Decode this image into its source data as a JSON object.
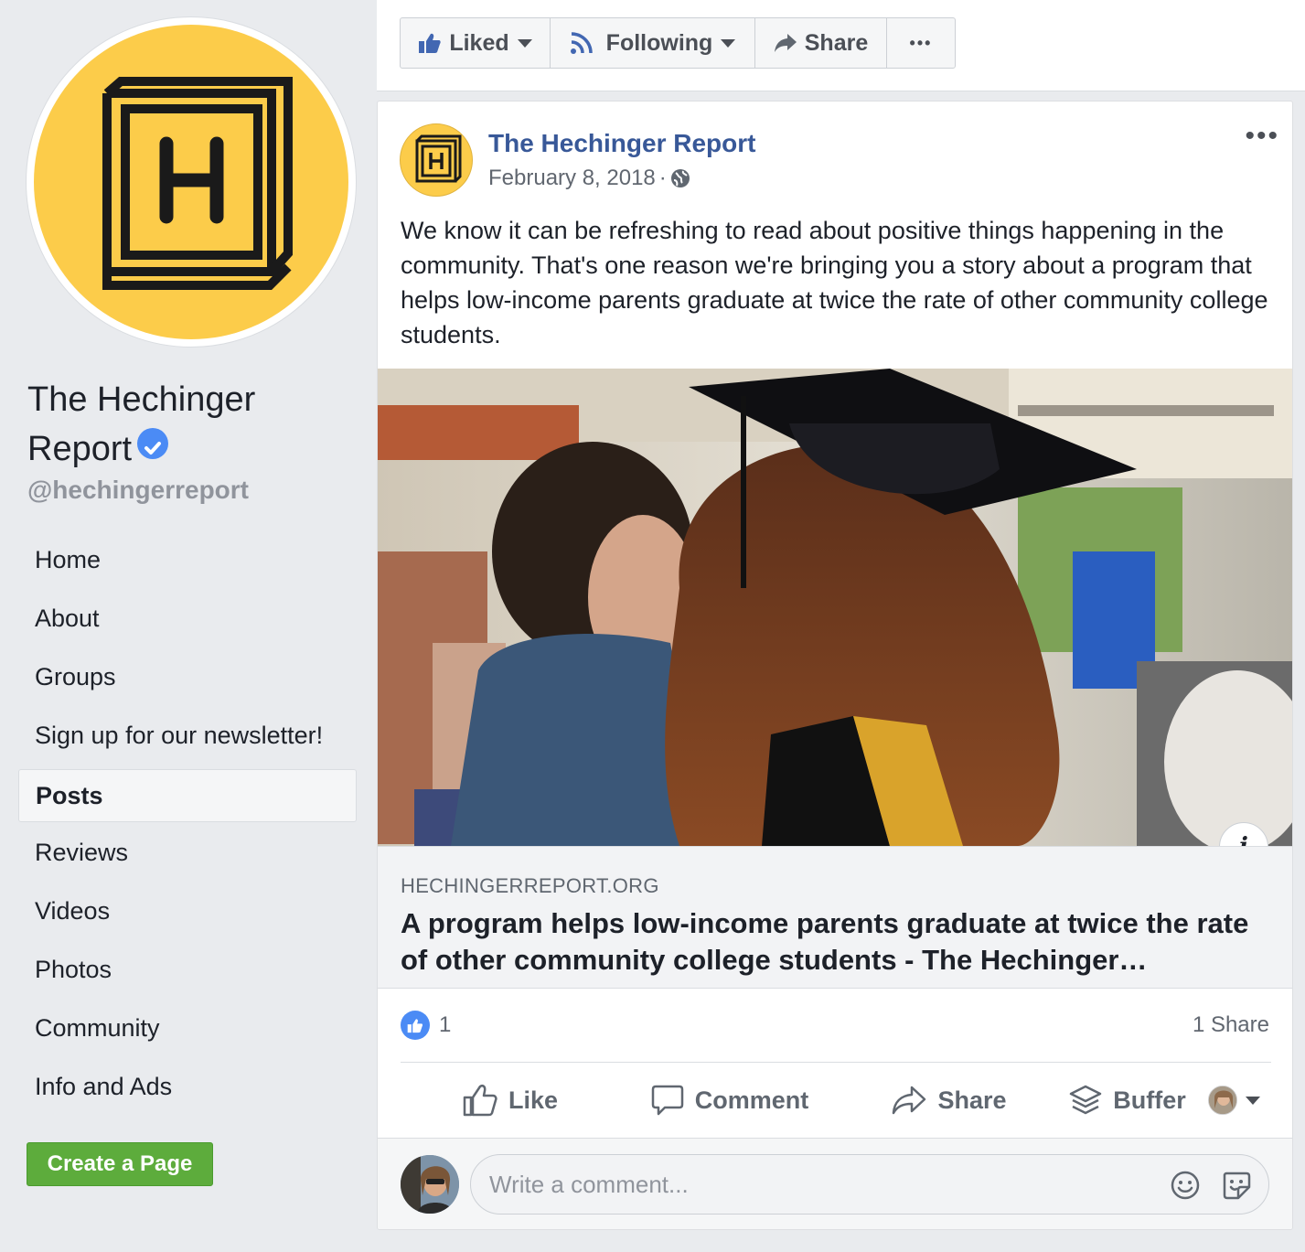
{
  "page": {
    "name_line1": "The Hechinger",
    "name_line2": "Report",
    "handle": "@hechingerreport",
    "logo_letter": "H",
    "brand_yellow": "#fccc4a"
  },
  "nav": {
    "items": [
      "Home",
      "About",
      "Groups",
      "Sign up for our newsletter!",
      "Posts",
      "Reviews",
      "Videos",
      "Photos",
      "Community",
      "Info and Ads"
    ],
    "active": "Posts"
  },
  "create_page_label": "Create a Page",
  "toolbar": {
    "liked_label": "Liked",
    "following_label": "Following",
    "share_label": "Share",
    "more_label": "•••"
  },
  "post": {
    "author": "The Hechinger Report",
    "date": "February 8, 2018",
    "separator": "·",
    "more_label": "•••",
    "text": "We know it can be refreshing to read about positive things happening in the community. That's one reason we're bringing you a story about a program that helps low-income parents graduate at twice the rate of other community college students.",
    "link": {
      "domain": "HECHINGERREPORT.ORG",
      "title": "A program helps low-income parents graduate at twice the rate of other community college students - The Hechinger…",
      "info_label": "i"
    },
    "like_count": "1",
    "share_count": "1 Share",
    "actions": {
      "like": "Like",
      "comment": "Comment",
      "share": "Share",
      "buffer": "Buffer"
    },
    "comment_placeholder": "Write a comment..."
  },
  "colors": {
    "link_blue": "#385898",
    "like_blue": "#4b8bf5",
    "create_green": "#5dac3c"
  },
  "icons": [
    "like-thumb-icon",
    "rss-following-icon",
    "share-arrow-icon",
    "more-dots-icon",
    "globe-icon",
    "verified-check-icon",
    "info-icon",
    "comment-bubble-icon",
    "buffer-stack-icon",
    "chevron-down-icon",
    "emoji-icon",
    "sticker-icon"
  ]
}
